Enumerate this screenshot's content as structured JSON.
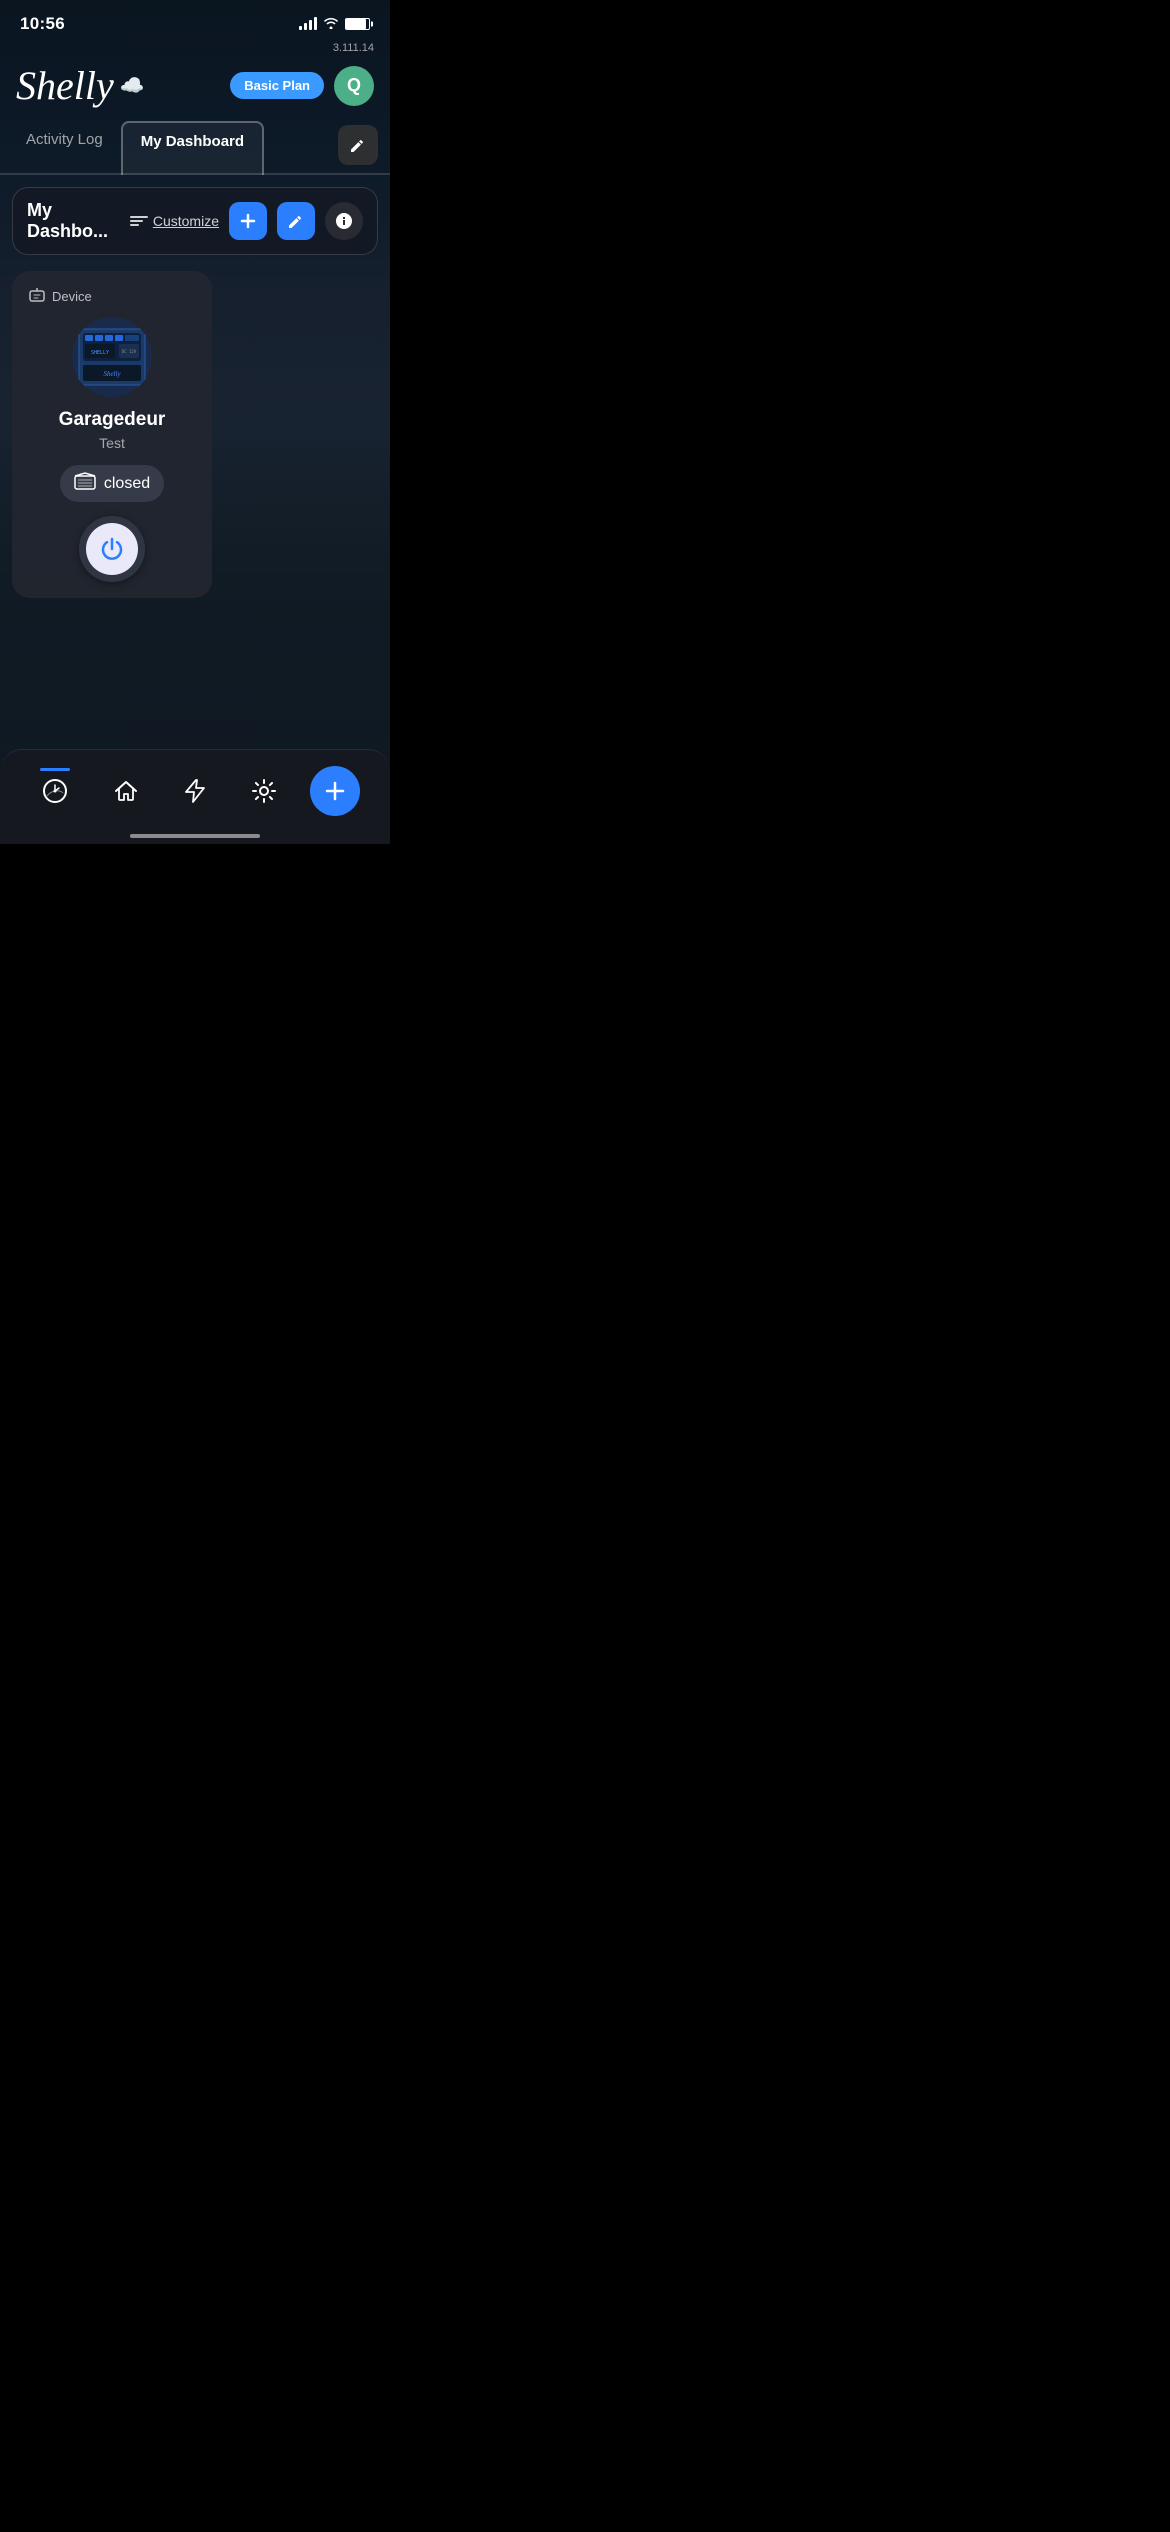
{
  "statusBar": {
    "time": "10:56",
    "version": "3.111.14"
  },
  "header": {
    "logo": "Shelly",
    "basicPlanLabel": "Basic Plan",
    "avatarInitial": "Q"
  },
  "tabs": [
    {
      "id": "activity-log",
      "label": "Activity Log",
      "active": false
    },
    {
      "id": "my-dashboard",
      "label": "My Dashboard",
      "active": true
    }
  ],
  "dashboard": {
    "title": "My Dashbo...",
    "customizeLabel": "Customize",
    "addLabel": "+",
    "editLabel": "✎",
    "infoLabel": "ℹ"
  },
  "deviceCard": {
    "typeLabel": "Device",
    "name": "Garagedeur",
    "subtitle": "Test",
    "status": "closed",
    "powerIcon": "⏻"
  },
  "bottomNav": {
    "items": [
      {
        "id": "dashboard",
        "icon": "◉",
        "active": true
      },
      {
        "id": "home",
        "icon": "⌂",
        "active": false
      },
      {
        "id": "scenes",
        "icon": "⚡",
        "active": false
      },
      {
        "id": "settings",
        "icon": "⚙",
        "active": false
      }
    ],
    "addButton": "+"
  }
}
